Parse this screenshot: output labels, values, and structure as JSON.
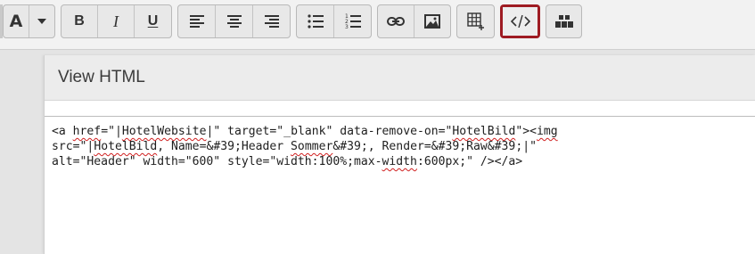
{
  "toolbar": {
    "font_color_label": "A",
    "bold_label": "B",
    "italic_label": "I",
    "underline_label": "U",
    "buttons": [
      {
        "name": "font-color",
        "icon": "font-color-icon"
      },
      {
        "name": "dropdown",
        "icon": "caret-down-icon"
      },
      {
        "name": "bold",
        "icon": "bold-icon"
      },
      {
        "name": "italic",
        "icon": "italic-icon"
      },
      {
        "name": "underline",
        "icon": "underline-icon"
      },
      {
        "name": "align-left",
        "icon": "align-left-icon"
      },
      {
        "name": "align-center",
        "icon": "align-center-icon"
      },
      {
        "name": "align-right",
        "icon": "align-right-icon"
      },
      {
        "name": "bullet-list",
        "icon": "bullet-list-icon"
      },
      {
        "name": "numbered-list",
        "icon": "numbered-list-icon"
      },
      {
        "name": "link",
        "icon": "link-icon"
      },
      {
        "name": "image",
        "icon": "image-icon"
      },
      {
        "name": "table",
        "icon": "table-icon"
      },
      {
        "name": "view-html",
        "icon": "code-icon",
        "active": true
      },
      {
        "name": "blocks",
        "icon": "blocks-icon"
      }
    ],
    "active_color": "#9e1b22"
  },
  "dialog": {
    "title": "View HTML",
    "code": {
      "line1": {
        "a": "<a ",
        "b": "href",
        "c": "=\"|",
        "d": "HotelWebsite",
        "e": "|\" target=\"_blank\" data-remove-on=\"",
        "f": "HotelBild",
        "g": "\"><",
        "h": "img"
      },
      "line2": {
        "a": "src=\"|",
        "b": "HotelBild",
        "c": ", Name=&#39;Header ",
        "d": "Sommer",
        "e": "&#39;, Render=&#39;Raw&#39;|\""
      },
      "line3": {
        "a": "alt=\"Header\" width=\"600\" style=\"width:100%;max-",
        "b": "width",
        "c": ":600px;\" /></a>"
      }
    }
  }
}
